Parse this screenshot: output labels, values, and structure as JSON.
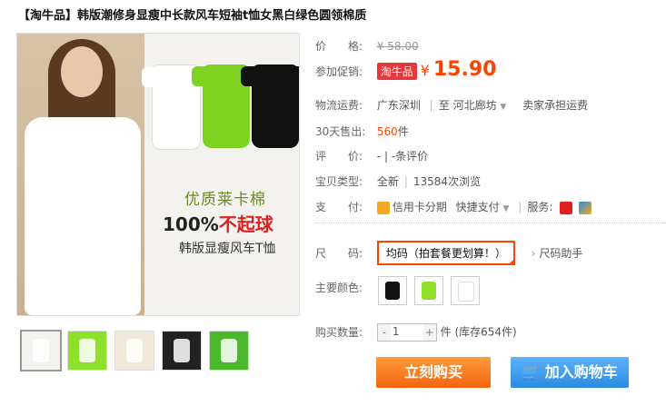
{
  "title": "【淘牛品】韩版潮修身显瘦中长款风车短袖t恤女黑白绿色圆领棉质",
  "image": {
    "slogan1": "优质莱卡棉",
    "slogan2a": "100%",
    "slogan2b": "不起球",
    "slogan3": "韩版显瘦风车T恤"
  },
  "price": {
    "label": "价　　格:",
    "original": "¥ 58.00"
  },
  "promo": {
    "label": "参加促销:",
    "tag": "淘牛品",
    "yen": "¥",
    "value": "15.90"
  },
  "shipping": {
    "label": "物流运费:",
    "from": "广东深圳",
    "sep": "至",
    "to": "河北廊坊",
    "note": "卖家承担运费"
  },
  "sales": {
    "label": "30天售出:",
    "count": "560",
    "unit": "件"
  },
  "review": {
    "label": "评　　价:",
    "text": "- | -条评价"
  },
  "type": {
    "label": "宝贝类型:",
    "value": "全新",
    "views": "13584次浏览"
  },
  "payment": {
    "label": "支　　付:",
    "credit": "信用卡分期",
    "quick": "快捷支付",
    "service_label": "服务:"
  },
  "size": {
    "label": "尺　　码:",
    "value": "均码（拍套餐更划算！）",
    "helper": "尺码助手"
  },
  "color": {
    "label": "主要颜色:"
  },
  "quantity": {
    "label": "购买数量:",
    "value": "1",
    "stock": "件 (库存654件)"
  },
  "buttons": {
    "buy": "立刻购买",
    "cart": "加入购物车"
  },
  "thumb_colors": [
    "#ffffff",
    "#8fe02a",
    "#f0e8d8",
    "#111111",
    "#4ab82a"
  ],
  "swatch_colors": [
    "#111111",
    "#8fe02a",
    "#ffffff"
  ]
}
